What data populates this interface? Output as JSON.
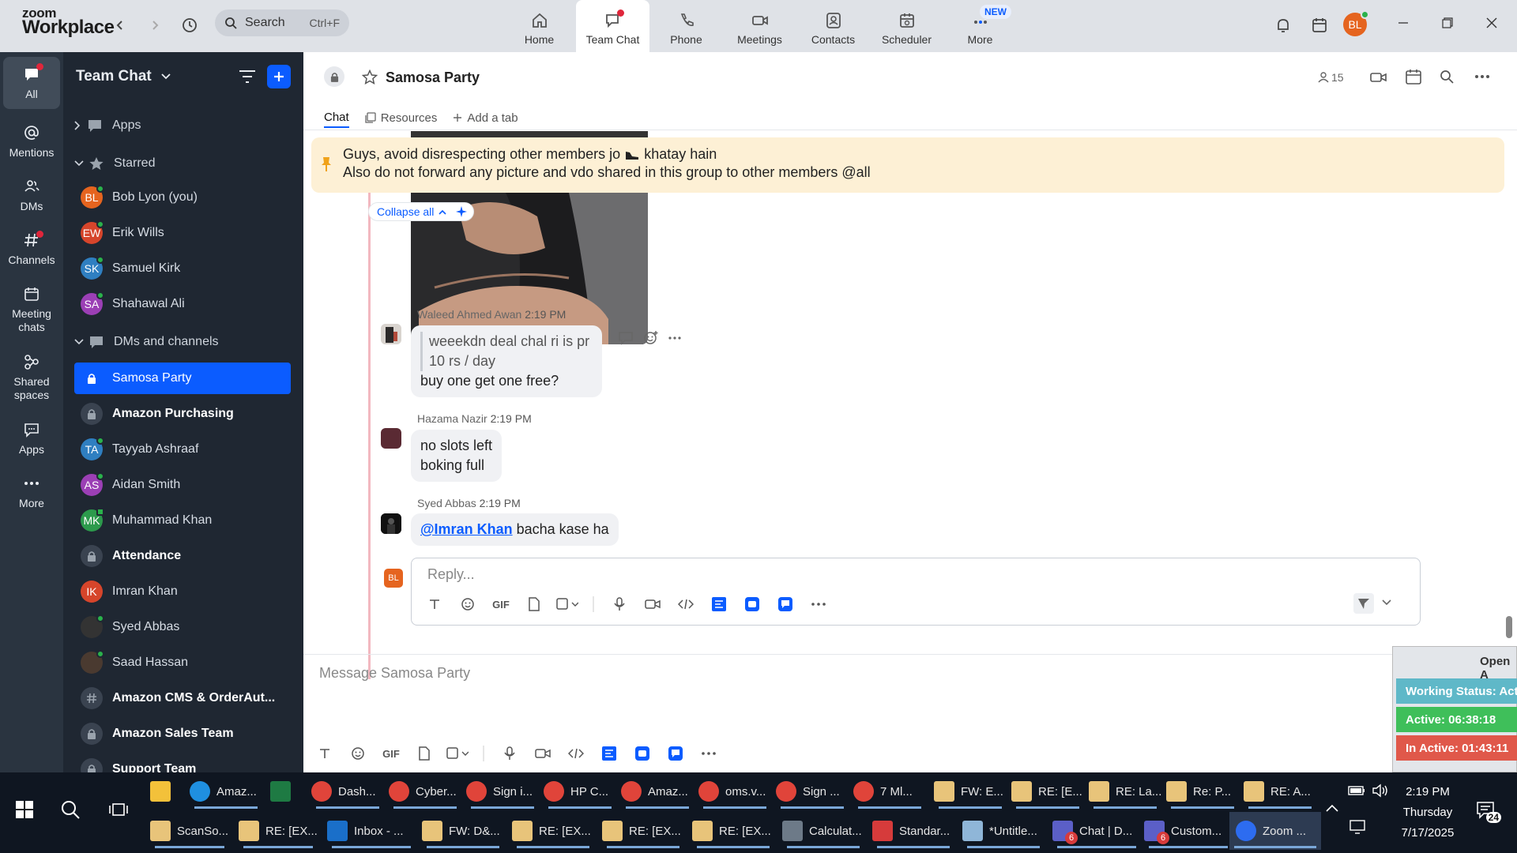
{
  "app": {
    "logo_line1": "zoom",
    "logo_line2": "Workplace"
  },
  "search": {
    "placeholder": "Search",
    "shortcut": "Ctrl+F"
  },
  "nav": {
    "items": [
      {
        "label": "Home",
        "icon": "home-icon"
      },
      {
        "label": "Team Chat",
        "icon": "team-chat-icon",
        "active": true
      },
      {
        "label": "Phone",
        "icon": "phone-icon"
      },
      {
        "label": "Meetings",
        "icon": "video-icon"
      },
      {
        "label": "Contacts",
        "icon": "contacts-icon"
      },
      {
        "label": "Scheduler",
        "icon": "scheduler-icon"
      },
      {
        "label": "More",
        "icon": "more-icon"
      }
    ],
    "new_badge": "NEW"
  },
  "user": {
    "initials": "BL",
    "color": "#e5641f"
  },
  "rail": {
    "items": [
      {
        "label": "All",
        "icon": "chat-bubble-icon"
      },
      {
        "label": "Mentions",
        "icon": "at-icon"
      },
      {
        "label": "DMs",
        "icon": "people-icon"
      },
      {
        "label": "Channels",
        "icon": "hash-icon"
      },
      {
        "label": "Meeting chats",
        "icon": "calendar-icon"
      },
      {
        "label": "Shared spaces",
        "icon": "shared-spaces-icon"
      },
      {
        "label": "Apps",
        "icon": "apps-icon"
      },
      {
        "label": "More",
        "icon": "more-dots-icon"
      }
    ]
  },
  "sidebar": {
    "title": "Team Chat",
    "apps_label": "Apps",
    "starred_label": "Starred",
    "starred": [
      {
        "name": "Bob Lyon (you)",
        "initials": "BL",
        "color": "#e5641f"
      },
      {
        "name": "Erik Wills",
        "initials": "EW",
        "color": "#d6452b"
      },
      {
        "name": "Samuel Kirk",
        "initials": "SK",
        "color": "#2f7fc1"
      },
      {
        "name": "Shahawal Ali",
        "initials": "SA",
        "color": "#9b3fb5"
      }
    ],
    "dms_label": "DMs and channels",
    "dms": [
      {
        "name": "Samosa Party",
        "kind": "lock",
        "selected": true
      },
      {
        "name": "Amazon Purchasing",
        "kind": "lock",
        "bold": true
      },
      {
        "name": "Tayyab Ashraaf",
        "initials": "TA",
        "color": "#2f7fc1"
      },
      {
        "name": "Aidan Smith",
        "initials": "AS",
        "color": "#9b3fb5"
      },
      {
        "name": "Muhammad Khan",
        "initials": "MK",
        "color": "#2c9a4c"
      },
      {
        "name": "Attendance",
        "kind": "lock",
        "bold": true
      },
      {
        "name": "Imran Khan",
        "initials": "IK",
        "color": "#d6452b"
      },
      {
        "name": "Syed Abbas",
        "initials": "",
        "color": "#333333"
      },
      {
        "name": "Saad Hassan",
        "initials": "",
        "color": "#4a3a30"
      },
      {
        "name": "Amazon CMS & OrderAut...",
        "kind": "hash",
        "bold": true
      },
      {
        "name": "Amazon Sales Team",
        "kind": "lock",
        "bold": true
      },
      {
        "name": "Support Team",
        "kind": "lock",
        "bold": true
      }
    ]
  },
  "channel": {
    "title": "Samosa Party",
    "member_count": "15",
    "tabs": [
      {
        "label": "Chat"
      },
      {
        "label": "Resources"
      },
      {
        "label": "Add a tab"
      }
    ]
  },
  "pinned": {
    "line1": "Guys, avoid disrespecting other members jo",
    "line1_end": "khatay hain",
    "line2": "Also do not forward any picture and vdo shared in this group to other members @all"
  },
  "thread": {
    "collapse_label": "Collapse all"
  },
  "messages": [
    {
      "sender": "Waleed Ahmed Awan",
      "time": "2:19 PM",
      "quote_line1": "weeekdn deal chal ri is pr",
      "quote_line2": "10 rs / day",
      "text": "buy one get one free?"
    },
    {
      "sender": "Hazama Nazir",
      "time": "2:19 PM",
      "line1": "no slots left",
      "line2": "boking full"
    },
    {
      "sender": "Syed Abbas",
      "time": "2:19 PM",
      "mention": "@Imran Khan",
      "text": "bacha kase ha"
    }
  ],
  "reply": {
    "placeholder": "Reply...",
    "gif": "GIF"
  },
  "composer": {
    "placeholder": "Message Samosa Party",
    "gif": "GIF"
  },
  "status_widget": {
    "open_label": "Open A",
    "working": "Working Status: Active",
    "active": "Active: 06:38:18",
    "inactive": "In Active: 01:43:11"
  },
  "taskbar": {
    "row1": [
      "Amaz...",
      "Dash...",
      "Cyber...",
      "Sign i...",
      "HP C...",
      "Amaz...",
      "oms.v...",
      "Sign ...",
      "7 Ml...",
      "FW: E...",
      "RE: [E...",
      "RE: La...",
      "Re: P...",
      "RE: A..."
    ],
    "row2": [
      "ScanSo...",
      "RE: [EX...",
      "Inbox - ...",
      "FW: D&...",
      "RE: [EX...",
      "RE: [EX...",
      "RE: [EX...",
      "Calculat...",
      "Standar...",
      "*Untitle...",
      "Chat | D...",
      "Custom...",
      "Zoom ..."
    ],
    "badge_6a": "6",
    "badge_6b": "6",
    "notif_count": "24",
    "time": "2:19 PM",
    "day": "Thursday",
    "date": "7/17/2025"
  }
}
